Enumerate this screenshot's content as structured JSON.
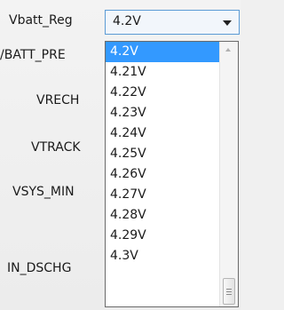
{
  "labels": {
    "vbatt_reg": "Vbatt_Reg",
    "vbatt_pre": "/BATT_PRE",
    "vrech": "VRECH",
    "vtrack": "VTRACK",
    "vsys_min": "VSYS_MIN",
    "in_dschg": "IN_DSCHG"
  },
  "combo": {
    "value": "4.2V"
  },
  "dropdown": {
    "options": [
      "4.2V",
      "4.21V",
      "4.22V",
      "4.23V",
      "4.24V",
      "4.25V",
      "4.26V",
      "4.27V",
      "4.28V",
      "4.29V",
      "4.3V"
    ],
    "selected_index": 0
  },
  "colors": {
    "selection": "#3399ff",
    "combo_border": "#5b9bd5"
  }
}
